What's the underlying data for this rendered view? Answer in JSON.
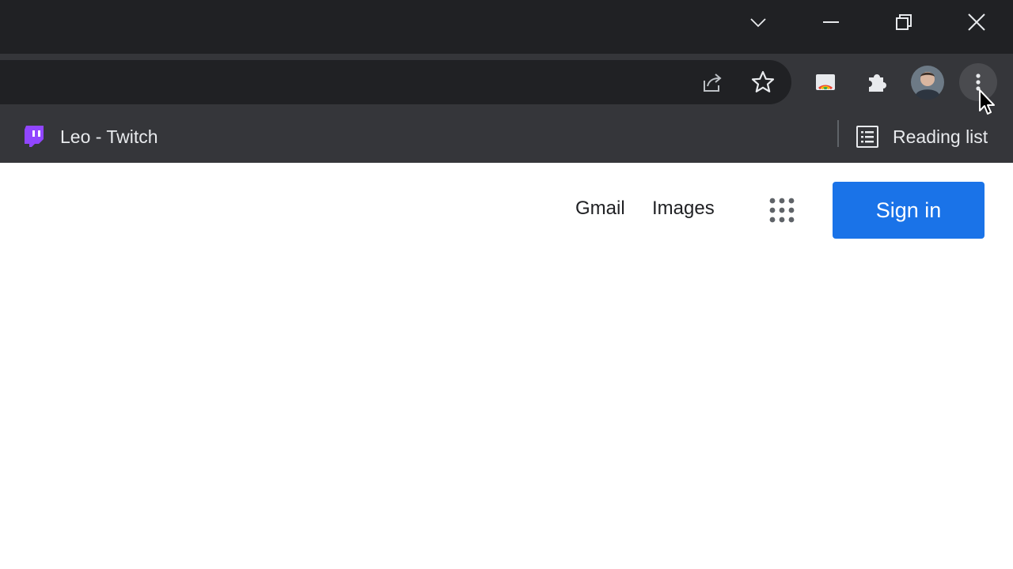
{
  "window_controls": {
    "tab_search": "chevron-down-icon",
    "minimize": "minimize-icon",
    "restore": "restore-icon",
    "close": "close-icon"
  },
  "toolbar": {
    "share_icon": "share-icon",
    "bookmark_icon": "star-icon",
    "extension_icon": "cast-extension-icon",
    "extensions_icon": "puzzle-icon",
    "profile_icon": "avatar",
    "menu_icon": "kebab-menu-icon"
  },
  "bookmarks_bar": {
    "items": [
      {
        "label": "Leo - Twitch",
        "icon": "twitch-icon",
        "icon_color": "#9146ff"
      }
    ],
    "reading_list_label": "Reading list"
  },
  "google": {
    "gmail_label": "Gmail",
    "images_label": "Images",
    "signin_label": "Sign in",
    "accent": "#1a73e8"
  }
}
